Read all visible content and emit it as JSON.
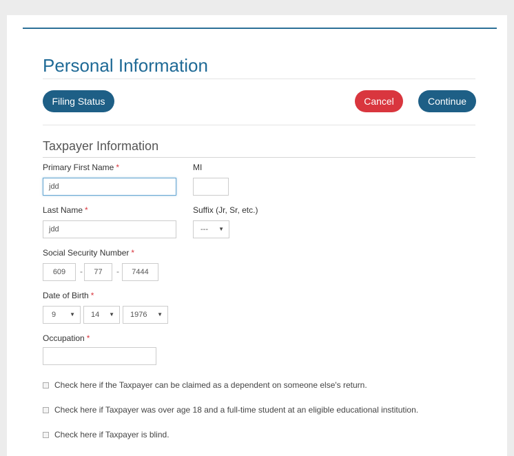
{
  "page": {
    "title": "Personal Information"
  },
  "toolbar": {
    "filing_status_label": "Filing Status",
    "cancel_label": "Cancel",
    "continue_label": "Continue"
  },
  "section": {
    "title": "Taxpayer Information"
  },
  "fields": {
    "first_name": {
      "label": "Primary First Name",
      "value": "jdd"
    },
    "mi": {
      "label": "MI",
      "value": ""
    },
    "last_name": {
      "label": "Last Name",
      "value": "jdd"
    },
    "suffix": {
      "label": "Suffix (Jr, Sr, etc.)",
      "value": "---"
    },
    "ssn": {
      "label": "Social Security Number",
      "part1": "609",
      "part2": "77",
      "part3": "7444"
    },
    "dob": {
      "label": "Date of Birth",
      "month": "9",
      "day": "14",
      "year": "1976"
    },
    "occupation": {
      "label": "Occupation",
      "value": ""
    }
  },
  "required_marker": "*",
  "separator": "-",
  "checkboxes": [
    {
      "label": "Check here if the Taxpayer can be claimed as a dependent on someone else's return.",
      "checked": false
    },
    {
      "label": "Check here if Taxpayer was over age 18 and a full-time student at an eligible educational institution.",
      "checked": false
    },
    {
      "label": "Check here if Taxpayer is blind.",
      "checked": false
    }
  ],
  "colors": {
    "primary": "#1e5f86",
    "danger": "#d9363e",
    "title": "#1f6a96"
  }
}
